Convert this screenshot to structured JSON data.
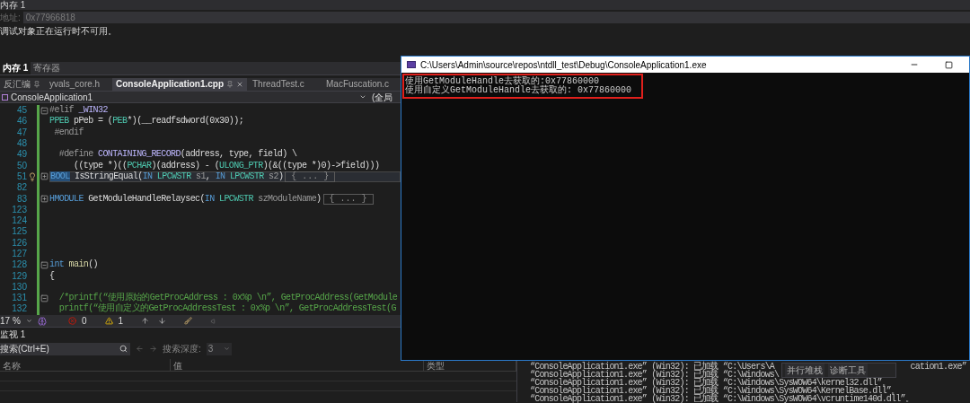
{
  "memory_panel": {
    "title": "内存 1",
    "address_label": "地址:",
    "address_value": "0x77966818",
    "message": "调试对象正在运行时不可用。"
  },
  "memory_tabs": [
    {
      "label": "内存 1",
      "selected": true
    },
    {
      "label": "寄存器",
      "selected": false
    }
  ],
  "document_tabs": [
    {
      "label": "反汇编",
      "selected": false,
      "pinned": true
    },
    {
      "label": "yvals_core.h",
      "selected": false,
      "pinned": false
    },
    {
      "label": "ConsoleApplication1.cpp",
      "selected": true,
      "pinned": true
    },
    {
      "label": "ThreadTest.c",
      "selected": false,
      "pinned": false
    },
    {
      "label": "MacFuscation.c",
      "selected": false,
      "pinned": false
    }
  ],
  "navigation": {
    "project": "ConsoleApplication1",
    "scope": "(全局"
  },
  "code_lines": [
    {
      "number": "45",
      "expanded": true,
      "tokens": [
        {
          "text": "#elif ",
          "kind": "directive"
        },
        {
          "text": "_WIN32",
          "kind": "macro"
        }
      ]
    },
    {
      "number": "46",
      "tokens": [
        {
          "text": "PPEB",
          "kind": "type"
        },
        {
          "text": " pPeb = (",
          "kind": "plain"
        },
        {
          "text": "PEB",
          "kind": "type"
        },
        {
          "text": "*)(__readfsdword(0x30));",
          "kind": "plain"
        }
      ]
    },
    {
      "number": "47",
      "tokens": [
        {
          "text": " #endif",
          "kind": "directive"
        }
      ]
    },
    {
      "number": "48"
    },
    {
      "number": "49",
      "tokens": [
        {
          "text": "  #define ",
          "kind": "directive"
        },
        {
          "text": "CONTAINING_RECORD",
          "kind": "macro"
        },
        {
          "text": "(address, type, field) \\",
          "kind": "plain"
        }
      ]
    },
    {
      "number": "50",
      "tokens": [
        {
          "text": "     ((type *)((",
          "kind": "plain"
        },
        {
          "text": "PCHAR",
          "kind": "type"
        },
        {
          "text": ")(address) - (",
          "kind": "plain"
        },
        {
          "text": "ULONG_PTR",
          "kind": "type"
        },
        {
          "text": ")(&((type *)0)->field)))",
          "kind": "plain"
        }
      ]
    },
    {
      "number": "51",
      "expanded": false,
      "selected": true,
      "lightbulb": true,
      "collapsed": "{ ... }",
      "tokens": [
        {
          "text": "BOOL",
          "kind": "keyword"
        },
        {
          "text": " IsStringEqual(",
          "kind": "plain"
        },
        {
          "text": "IN",
          "kind": "keyword"
        },
        {
          "text": " LPCWSTR",
          "kind": "type"
        },
        {
          "text": " s1",
          "kind": "param"
        },
        {
          "text": ", ",
          "kind": "plain"
        },
        {
          "text": "IN",
          "kind": "keyword"
        },
        {
          "text": " LPCWSTR",
          "kind": "type"
        },
        {
          "text": " s2",
          "kind": "param"
        },
        {
          "text": ")",
          "kind": "plain"
        }
      ]
    },
    {
      "number": "82"
    },
    {
      "number": "83",
      "expanded": false,
      "collapsed": "{ ... }",
      "tokens": [
        {
          "text": "HMODULE",
          "kind": "keyword"
        },
        {
          "text": " GetModuleHandleRelaysec(",
          "kind": "plain"
        },
        {
          "text": "IN",
          "kind": "keyword"
        },
        {
          "text": " LPCWSTR",
          "kind": "type"
        },
        {
          "text": " szModuleName",
          "kind": "param"
        },
        {
          "text": ")",
          "kind": "plain"
        }
      ]
    },
    {
      "number": "123"
    },
    {
      "number": "124"
    },
    {
      "number": "125"
    },
    {
      "number": "126"
    },
    {
      "number": "127"
    },
    {
      "number": "128",
      "expanded": true,
      "tokens": [
        {
          "text": "int",
          "kind": "keyword"
        },
        {
          "text": " main",
          "kind": "function"
        },
        {
          "text": "()",
          "kind": "plain"
        }
      ]
    },
    {
      "number": "129",
      "tokens": [
        {
          "text": "{",
          "kind": "plain"
        }
      ]
    },
    {
      "number": "130"
    },
    {
      "number": "131",
      "expanded": true,
      "tokens": [
        {
          "text": "  /*printf(“使用原始的GetProcAddress : 0x%p \\n”, GetProcAddress(GetModule",
          "kind": "comment"
        }
      ]
    },
    {
      "number": "132",
      "tokens": [
        {
          "text": "  printf(“使用自定义的GetProcAddressTest : 0x%p \\n”, GetProcAddressTest(G",
          "kind": "comment"
        }
      ]
    }
  ],
  "status_bar": {
    "zoom": "17 %",
    "errors": "0",
    "warnings": "1"
  },
  "watch_panel": {
    "title": "监视 1",
    "search_placeholder": "搜索(Ctrl+E)",
    "depth_label": "搜索深度:",
    "depth_value": "3",
    "depth_disabled": true,
    "columns": [
      "名称",
      "值",
      "类型"
    ]
  },
  "output_lines": [
    {
      "text": "“ConsoleApplication1.exe” (Win32): 已加载 “C:\\Users\\A",
      "tail": "cation1.exe”"
    },
    {
      "text": "“ConsoleApplication1.exe” (Win32): 已加载 “C:\\Windows\\"
    },
    {
      "text": "“ConsoleApplication1.exe” (Win32): 已加载 “C:\\Windows\\SysWOW64\\kernel32.dll”。"
    },
    {
      "text": "“ConsoleApplication1.exe” (Win32): 已加载 “C:\\Windows\\SysWOW64\\KernelBase.dll”。"
    },
    {
      "text": "“ConsoleApplication1.exe” (Win32): 已加载 “C:\\Windows\\SysWOW64\\vcruntime140d.dll”。"
    }
  ],
  "popup_tabs": [
    "并行堆栈",
    "诊断工具"
  ],
  "console": {
    "title": "C:\\Users\\Admin\\source\\repos\\ntdll_test\\Debug\\ConsoleApplication1.exe",
    "highlighted": true,
    "lines": [
      "使用GetModuleHandle去获取的:0x77860000",
      "使用自定义GetModuleHandle去获取的: 0x77860000"
    ]
  }
}
